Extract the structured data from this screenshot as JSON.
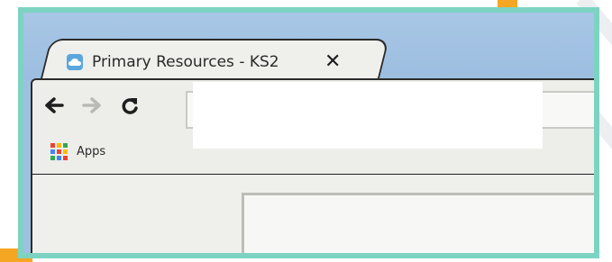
{
  "browser": {
    "tab": {
      "title": "Primary Resources - KS2",
      "favicon": "cloud-icon",
      "close_label": "✕"
    },
    "toolbar": {
      "back_icon": "arrow-left-icon",
      "forward_icon": "arrow-right-icon",
      "reload_icon": "reload-icon"
    },
    "bookmarks": {
      "apps_label": "Apps",
      "apps_icon": "apps-grid-icon"
    }
  },
  "colors": {
    "frame": "#7dd3c2",
    "accent_orange": "#f5a623",
    "sky": "#a8c7e6",
    "apps_grid": [
      "#ea4335",
      "#fbbc05",
      "#34a853",
      "#4285f4",
      "#ea4335",
      "#fbbc05",
      "#34a853",
      "#4285f4",
      "#ea4335"
    ]
  }
}
